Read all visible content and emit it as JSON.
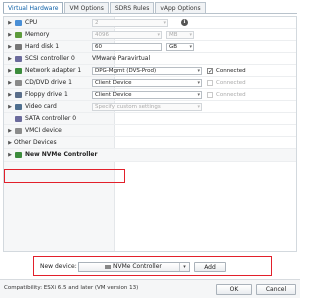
{
  "tabs": [
    {
      "label": "Virtual Hardware",
      "active": true
    },
    {
      "label": "VM Options",
      "active": false
    },
    {
      "label": "SDRS Rules",
      "active": false
    },
    {
      "label": "vApp Options",
      "active": false
    }
  ],
  "rows": {
    "cpu": {
      "label": "CPU",
      "value": "2",
      "info_icon": "i"
    },
    "memory": {
      "label": "Memory",
      "value": "4096",
      "unit": "MB"
    },
    "hard_disk": {
      "label": "Hard disk 1",
      "value": "60",
      "unit": "GB"
    },
    "scsi": {
      "label": "SCSI controller 0",
      "value": "VMware Paravirtual"
    },
    "network": {
      "label": "Network adapter 1",
      "value": "DPG-Mgmt (DVS-Prod)",
      "connected_label": "Connected",
      "connected": true
    },
    "cddvd": {
      "label": "CD/DVD drive 1",
      "value": "Client Device",
      "connected_label": "Connected",
      "connected": false
    },
    "floppy": {
      "label": "Floppy drive 1",
      "value": "Client Device",
      "connected_label": "Connected",
      "connected": false
    },
    "video": {
      "label": "Video card",
      "value": "Specify custom settings"
    },
    "sata": {
      "label": "SATA controller 0"
    },
    "vmci": {
      "label": "VMCI device"
    },
    "other": {
      "label": "Other Devices"
    },
    "nvme": {
      "label": "New NVMe Controller"
    }
  },
  "new_device": {
    "label": "New device:",
    "selected": "NVMe Controller",
    "add_label": "Add"
  },
  "footer": {
    "compatibility": "Compatibility: ESXi 6.5 and later (VM version 13)",
    "ok_label": "OK",
    "cancel_label": "Cancel"
  },
  "colors": {
    "highlight_border": "#e2202b",
    "active_tab_text": "#0a5fa8"
  }
}
